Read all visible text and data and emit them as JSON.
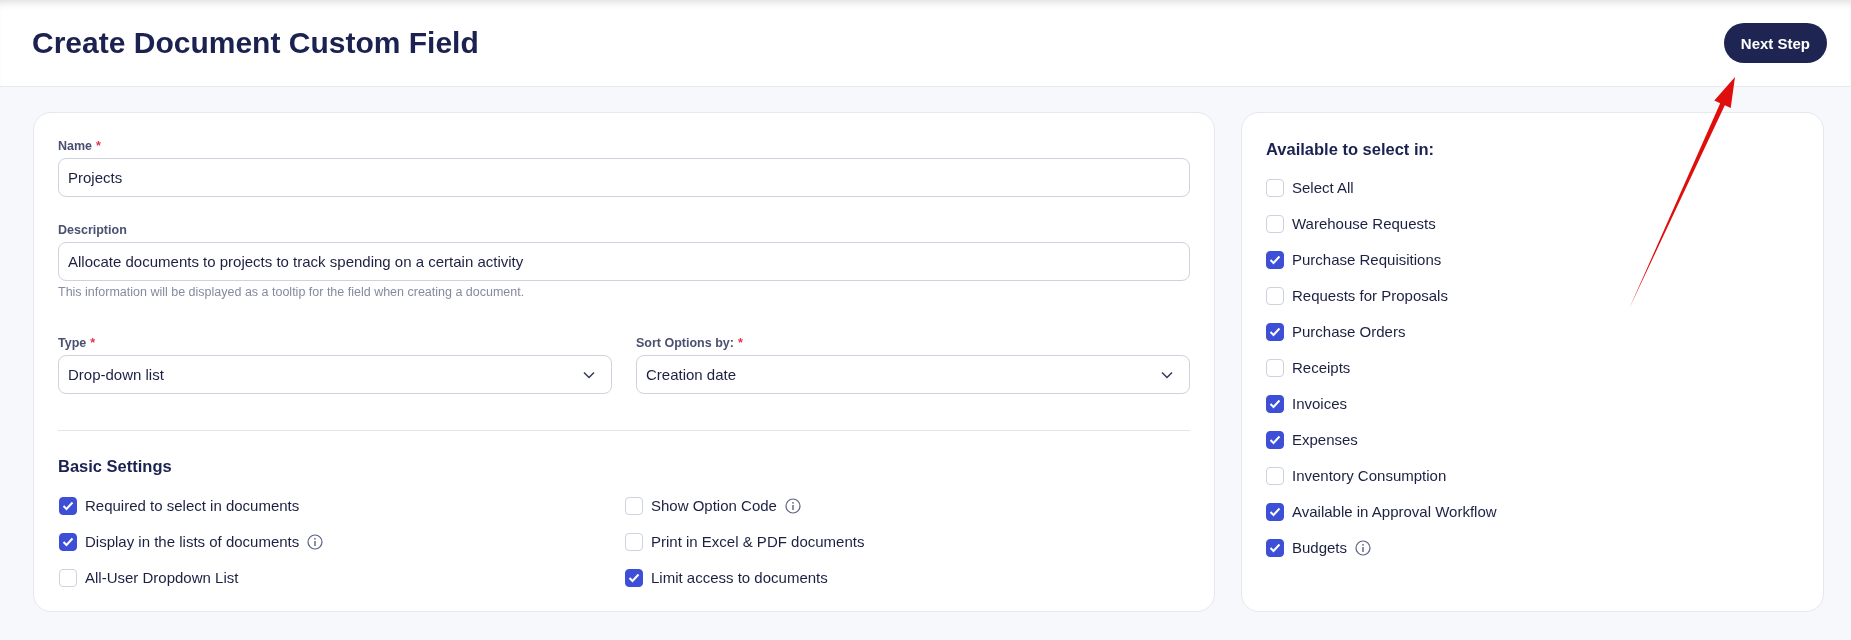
{
  "header": {
    "title": "Create Document Custom Field",
    "next_button": "Next Step"
  },
  "form": {
    "name": {
      "label": "Name",
      "required_mark": "*",
      "value": "Projects"
    },
    "description": {
      "label": "Description",
      "value": "Allocate documents to projects to track spending on a certain activity",
      "hint": "This information will be displayed as a tooltip for the field when creating a document."
    },
    "selects": [
      {
        "label": "Type",
        "required_mark": "*",
        "value": "Drop-down list"
      },
      {
        "label": "Sort Options by:",
        "required_mark": "*",
        "value": "Creation date"
      }
    ],
    "basic_settings": {
      "title": "Basic Settings",
      "columns": [
        [
          {
            "label": "Required to select in documents",
            "checked": true
          },
          {
            "label": "Display in the lists of documents",
            "checked": true,
            "info": true
          },
          {
            "label": "All-User Dropdown List",
            "checked": false
          }
        ],
        [
          {
            "label": "Show Option Code",
            "checked": false,
            "info": true
          },
          {
            "label": "Print in Excel & PDF documents",
            "checked": false
          },
          {
            "label": "Limit access to documents",
            "checked": true
          }
        ]
      ]
    }
  },
  "availability": {
    "title": "Available to select in:",
    "items": [
      {
        "label": "Select All",
        "checked": false
      },
      {
        "label": "Warehouse Requests",
        "checked": false
      },
      {
        "label": "Purchase Requisitions",
        "checked": true
      },
      {
        "label": "Requests for Proposals",
        "checked": false
      },
      {
        "label": "Purchase Orders",
        "checked": true
      },
      {
        "label": "Receipts",
        "checked": false
      },
      {
        "label": "Invoices",
        "checked": true
      },
      {
        "label": "Expenses",
        "checked": true
      },
      {
        "label": "Inventory Consumption",
        "checked": false
      },
      {
        "label": "Available in Approval Workflow",
        "checked": true
      },
      {
        "label": "Budgets",
        "checked": true,
        "info": true
      }
    ]
  }
}
